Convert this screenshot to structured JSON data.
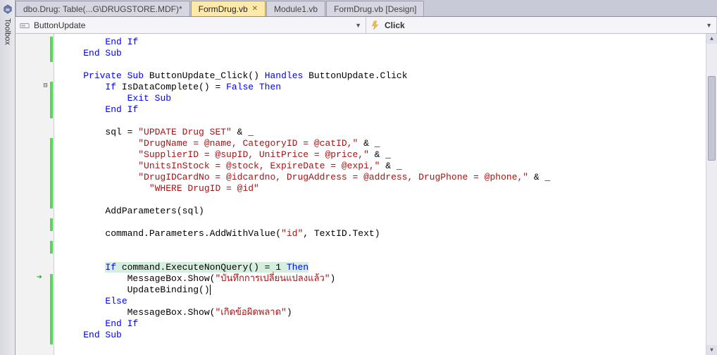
{
  "toolbox": {
    "label": "Toolbox"
  },
  "tabs": [
    {
      "label": "dbo.Drug: Table(...G\\DRUGSTORE.MDF)*",
      "active": false
    },
    {
      "label": "FormDrug.vb",
      "active": true
    },
    {
      "label": "Module1.vb",
      "active": false
    },
    {
      "label": "FormDrug.vb [Design]",
      "active": false
    }
  ],
  "dropdowns": {
    "left": "ButtonUpdate",
    "right": "Click"
  },
  "code": {
    "l1a": "End",
    "l1b": " If",
    "l2a": "End",
    "l2b": " Sub",
    "l3a": "Private",
    "l3b": " Sub",
    "l3c": " ButtonUpdate_Click() ",
    "l3d": "Handles",
    "l3e": " ButtonUpdate.Click",
    "l4a": "If",
    "l4b": " IsDataComplete() = ",
    "l4c": "False",
    "l4d": " Then",
    "l5a": "Exit",
    "l5b": " Sub",
    "l6a": "End",
    "l6b": " If",
    "l7a": "sql = ",
    "l7b": "\"UPDATE Drug SET\"",
    "l7c": " & _",
    "l8a": "\"DrugName = @name, CategoryID = @catID,\"",
    "l8b": " & _",
    "l9a": "\"SupplierID = @supID, UnitPrice = @price,\"",
    "l9b": " & _",
    "l10a": "\"UnitsInStock = @stock, ExpireDate = @expi,\"",
    "l10b": " & _",
    "l11a": "\"DrugIDCardNo = @idcardno, DrugAddress = @address, DrugPhone = @phone,\"",
    "l11b": " & _",
    "l12a": "\"WHERE DrugID = @id\"",
    "l13": "AddParameters(sql)",
    "l14a": "command.Parameters.AddWithValue(",
    "l14b": "\"id\"",
    "l14c": ", TextID.Text)",
    "l15a": "If",
    "l15b": " command.ExecuteNonQuery() = 1 ",
    "l15c": "Then",
    "l16a": "MessageBox.Show(",
    "l16b": "\"บันทึกการเปลี่ยนแปลงแล้ว\"",
    "l16c": ")",
    "l17": "UpdateBinding()",
    "l18": "Else",
    "l19a": "MessageBox.Show(",
    "l19b": "\"เกิดข้อผิดพลาด\"",
    "l19c": ")",
    "l20a": "End",
    "l20b": " If",
    "l21a": "End",
    "l21b": " Sub"
  }
}
